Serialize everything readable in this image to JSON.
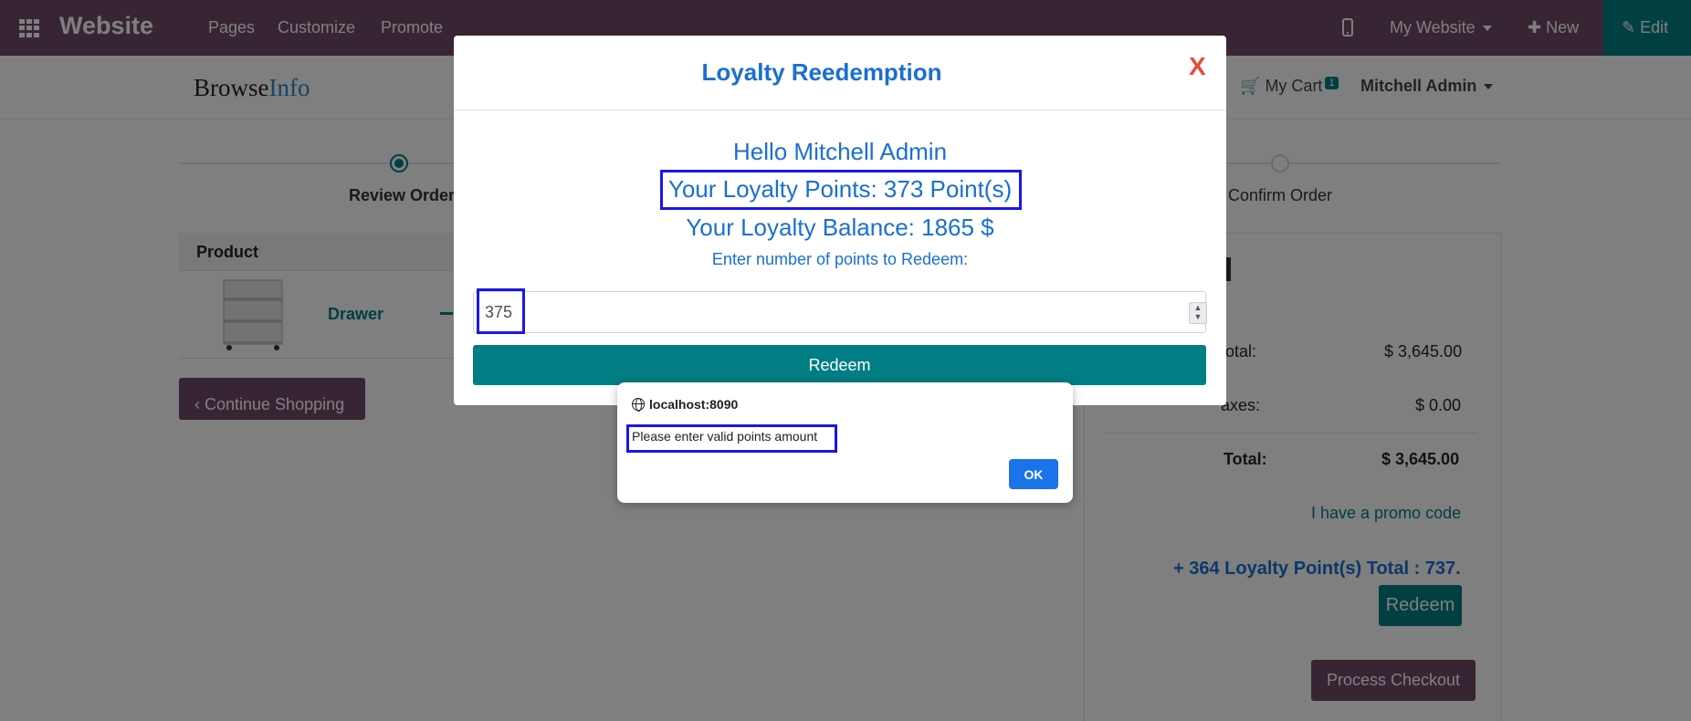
{
  "navbar": {
    "brand": "Website",
    "links": [
      "Pages",
      "Customize",
      "Promote"
    ],
    "my_website": "My Website",
    "new_label": "New",
    "edit_label": "Edit"
  },
  "header": {
    "logo_part1": "Browse",
    "logo_part2": "Info",
    "cart_label": "My Cart",
    "cart_count": "1",
    "user": "Mitchell Admin"
  },
  "steps": {
    "step1": "Review Order",
    "step3": "Confirm Order"
  },
  "product_table": {
    "header": "Product",
    "product_name": "Drawer"
  },
  "continue_label": "Continue Shopping",
  "summary": {
    "subtotal_label": "total:",
    "subtotal_value": "$ 3,645.00",
    "taxes_label": "axes:",
    "taxes_value": "$ 0.00",
    "total_label": "Total:",
    "total_value": "$ 3,645.00",
    "promo": "I have a promo code",
    "loyalty_line": "+ 364 Loyalty Point(s) Total : 737.",
    "redeem_label": "Redeem",
    "checkout_label": "Process Checkout"
  },
  "modal": {
    "title": "Loyalty Reedemption",
    "close": "X",
    "greeting": "Hello Mitchell Admin",
    "points": "Your Loyalty Points: 373 Point(s)",
    "balance": "Your Loyalty Balance: 1865 $",
    "prompt": "Enter number of points to Redeem:",
    "input_value": "375",
    "redeem_label": "Redeem"
  },
  "alert": {
    "origin": "localhost:8090",
    "message": "Please enter valid points amount",
    "ok_label": "OK"
  }
}
